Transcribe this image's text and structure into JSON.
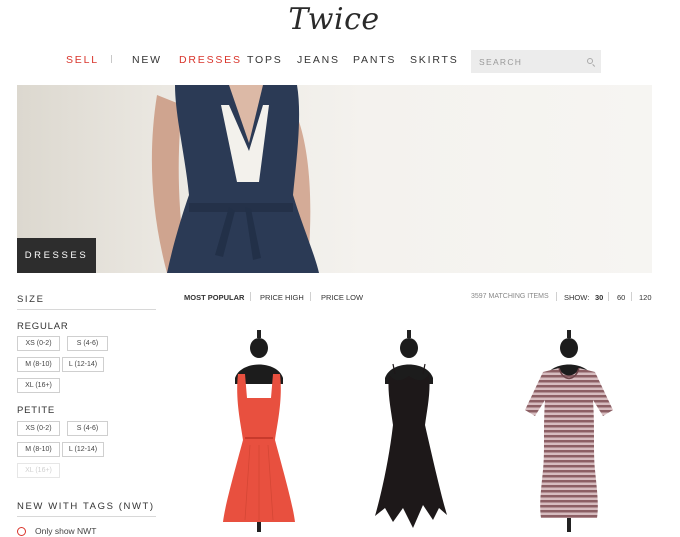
{
  "brand": {
    "logo_text": "Twice"
  },
  "nav": {
    "sell": "SELL",
    "items": [
      "NEW",
      "DRESSES",
      "TOPS",
      "JEANS",
      "PANTS",
      "SKIRTS"
    ],
    "active": "DRESSES",
    "search_placeholder": "SEARCH"
  },
  "hero": {
    "label": "DRESSES"
  },
  "sidebar": {
    "size_title": "SIZE",
    "regular_title": "REGULAR",
    "regular_sizes": [
      "XS (0-2)",
      "S (4-6)",
      "M (8-10)",
      "L (12-14)",
      "XL (16+)"
    ],
    "petite_title": "PETITE",
    "petite_sizes": [
      "XS (0-2)",
      "S (4-6)",
      "M (8-10)",
      "L (12-14)",
      "XL (16+)"
    ],
    "petite_disabled": [
      "XL (16+)"
    ],
    "nwt_title": "NEW WITH TAGS (NWT)",
    "nwt_option": "Only show NWT"
  },
  "sort": {
    "options": [
      "MOST POPULAR",
      "PRICE HIGH",
      "PRICE LOW"
    ],
    "active": "MOST POPULAR"
  },
  "results": {
    "count_label": "3597 MATCHING ITEMS",
    "show_label": "SHOW:",
    "show_options": [
      "30",
      "60",
      "120"
    ],
    "show_active": "30"
  },
  "products": [
    {
      "name": "coral-sundress",
      "color": "#e8503f"
    },
    {
      "name": "black-slip-dress",
      "color": "#1d1819"
    },
    {
      "name": "striped-tshirt-dress",
      "color": "#8c5f64"
    }
  ],
  "colors": {
    "accent": "#d9342b",
    "hero_dress": "#2b3a55"
  }
}
